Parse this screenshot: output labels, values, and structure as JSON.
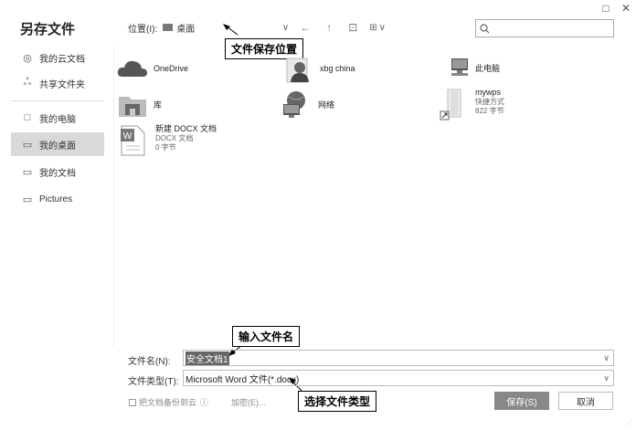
{
  "window": {
    "minimize_icon": "□",
    "close_icon": "✕"
  },
  "title": "另存文件",
  "toolbar": {
    "location_label": "位置(I):",
    "location_value": "桌面",
    "back_icon": "←",
    "up_icon": "↑",
    "new_folder_icon": "⊡",
    "view_icon": "⊞",
    "view_chevron": "∨"
  },
  "search": {
    "placeholder": ""
  },
  "annotations": {
    "location": "文件保存位置",
    "filename": "输入文件名",
    "filetype": "选择文件类型"
  },
  "sidebar": {
    "items": [
      {
        "label": "我的云文档"
      },
      {
        "label": "共享文件夹"
      },
      {
        "label": "我的电脑"
      },
      {
        "label": "我的桌面"
      },
      {
        "label": "我的文档"
      },
      {
        "label": "Pictures"
      }
    ]
  },
  "files": [
    {
      "name": "OneDrive",
      "sub1": "",
      "sub2": ""
    },
    {
      "name": "xbg china",
      "sub1": "",
      "sub2": ""
    },
    {
      "name": "此电脑",
      "sub1": "",
      "sub2": ""
    },
    {
      "name": "库",
      "sub1": "",
      "sub2": ""
    },
    {
      "name": "网络",
      "sub1": "",
      "sub2": ""
    },
    {
      "name": "mywps",
      "sub1": "快捷方式",
      "sub2": "822 字节"
    },
    {
      "name": "新建 DOCX 文档",
      "sub1": "DOCX 文档",
      "sub2": "0 字节"
    }
  ],
  "form": {
    "filename_label": "文件名(N):",
    "filename_value": "安全文档1",
    "filetype_label": "文件类型(T):",
    "filetype_value": "Microsoft Word 文件(*.docx)",
    "backup_label": "把文档备份到云",
    "encrypt_label": "加密(E)...",
    "save_label": "保存(S)",
    "cancel_label": "取消"
  }
}
